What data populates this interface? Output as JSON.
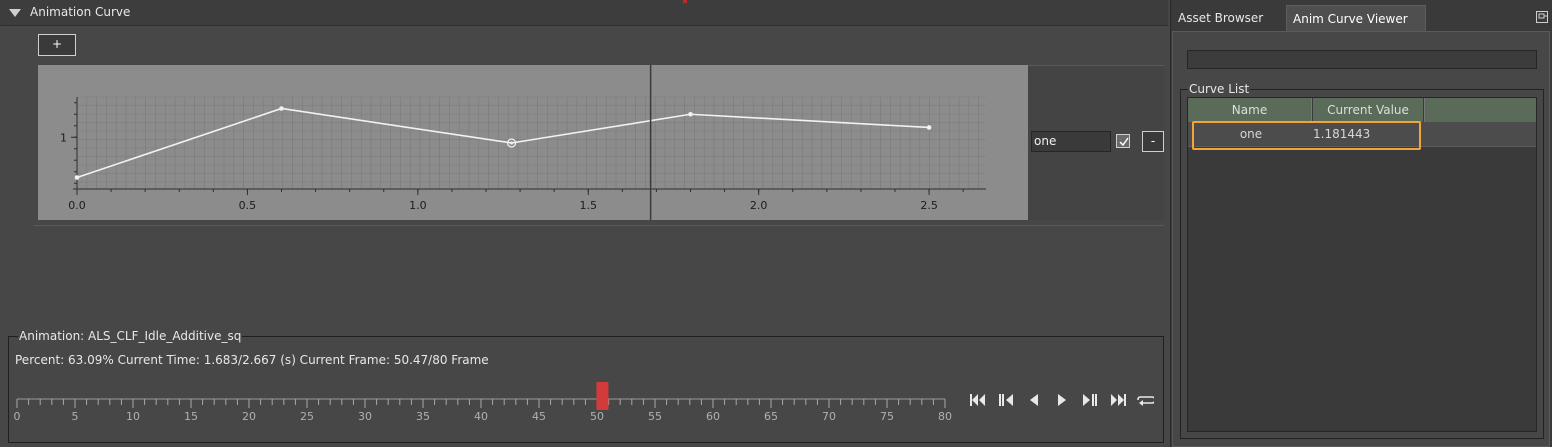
{
  "curve_panel": {
    "title": "Animation Curve",
    "add_label": "+",
    "remove_label": "-",
    "curve_name_value": "one",
    "curve_enabled": true
  },
  "chart_data": {
    "type": "line",
    "title": "",
    "xlabel": "",
    "ylabel": "",
    "x_ticks": [
      "0.0",
      "0.5",
      "1.0",
      "1.5",
      "2.0",
      "2.5"
    ],
    "y_ticks": [
      "1"
    ],
    "xlim": [
      0.0,
      2.667
    ],
    "ylim": [
      0.1,
      1.7
    ],
    "grid": true,
    "cursor_time": 1.683,
    "series": [
      {
        "x": [
          0.0,
          0.6,
          1.275,
          1.8,
          2.5
        ],
        "y": [
          0.3,
          1.5,
          0.9,
          1.4,
          1.17
        ]
      }
    ],
    "selected_key_index": 2
  },
  "animation": {
    "legend": "Animation: ALS_CLF_Idle_Additive_sq",
    "stats": "Percent: 63.09% Current Time: 1.683/2.667 (s) Current Frame: 50.47/80 Frame",
    "current_frame": 50.47,
    "total_frames": 80,
    "frame_ticks": [
      "0",
      "5",
      "10",
      "15",
      "20",
      "25",
      "30",
      "35",
      "40",
      "45",
      "50",
      "55",
      "60",
      "65",
      "70",
      "75",
      "80"
    ]
  },
  "transport": {
    "icons": [
      "skip-start-icon",
      "step-back-icon",
      "play-reverse-icon",
      "play-icon",
      "step-forward-icon",
      "skip-end-icon",
      "loop-icon"
    ]
  },
  "right_panel": {
    "tabs": [
      {
        "label": "Asset Browser"
      },
      {
        "label": "Anim Curve Viewer"
      }
    ],
    "curve_list_legend": "Curve List",
    "columns": [
      "Name",
      "Current Value"
    ],
    "rows": [
      {
        "name": "one",
        "value": "1.181443"
      }
    ]
  },
  "colors": {
    "accent_highlight": "#f4a23a",
    "playhead": "#d33a3a",
    "header_green": "#5a6b5a"
  }
}
